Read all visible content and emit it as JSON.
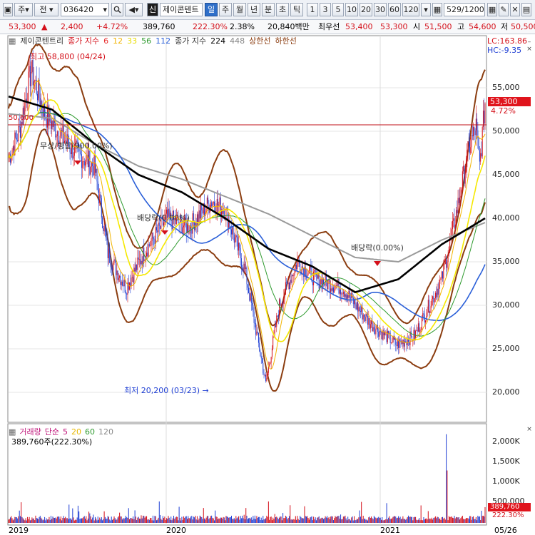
{
  "toolbar": {
    "type_label": "주",
    "market_label": "전",
    "code": "036420",
    "search_icon": "magnifier-icon",
    "sound_icon": "speaker-icon",
    "new_label": "신",
    "name": "제이콘텐트",
    "periods": [
      "일",
      "주",
      "월",
      "년",
      "분",
      "초",
      "틱"
    ],
    "period_selected": "일",
    "intervals": [
      "1",
      "3",
      "5",
      "10",
      "20",
      "30",
      "60",
      "120"
    ],
    "count": "529",
    "count_total": "/1200"
  },
  "quote": {
    "price": "53,300",
    "change_arrow": "▲",
    "change": "2,400",
    "change_pct": "+4.72%",
    "volume": "389,760",
    "volume_ratio": "222.30%",
    "turnover": "2.38%",
    "amount": "20,840백만",
    "ask_label": "최우선",
    "ask1": "53,400",
    "ask2": "53,300",
    "open_label": "시",
    "open": "51,500",
    "high_label": "고",
    "high": "54,600",
    "low_label": "저",
    "low": "50,500"
  },
  "legend": {
    "name": "제이콘텐트리",
    "ma_label": "종가 지수",
    "ma_periods": [
      "6",
      "12",
      "33",
      "56",
      "112"
    ],
    "ma2_label": "종가 지수",
    "ma2_periods": [
      "224",
      "448"
    ],
    "upper_label": "상한선",
    "lower_label": "하한선",
    "lc": "LC:163.86",
    "hc": "HC:-9.35"
  },
  "annotations": {
    "high": "최고 58,800 (04/24)",
    "low": "최저 20,200 (03/23)",
    "dividend1": "무상/병합(900.00%)",
    "dividend2": "배당락(0.00%)",
    "dividend3": "배당락(0.00%)",
    "level_label": "50,600"
  },
  "price_axis": {
    "ticks": [
      "55,000",
      "50,000",
      "45,000",
      "40,000",
      "35,000",
      "30,000",
      "25,000",
      "20,000"
    ],
    "current": "53,300",
    "current_pct": "4.72%"
  },
  "volume": {
    "label": "거래량",
    "ma_label": "단순",
    "ma_periods": [
      "5",
      "20",
      "60",
      "120"
    ],
    "current": "389,760주(222.30%)",
    "ticks": [
      "2,000K",
      "1,500K",
      "1,000K",
      "500,000"
    ],
    "current_box": "389,760",
    "current_pct": "222.30%"
  },
  "date_axis": [
    "2019",
    "2020",
    "2021",
    "05/26"
  ],
  "colors": {
    "up": "#d4101a",
    "down": "#1f3fd4",
    "ma6": "#e83030",
    "ma12": "#f2b400",
    "ma33": "#f5e800",
    "ma56": "#2e9a2e",
    "ma112": "#2a5fd8",
    "ma224": "#000000",
    "ma448": "#9a9a9a",
    "envelope": "#8b3d10"
  },
  "chart_data": {
    "type": "line",
    "x": [
      "2019-01",
      "2019-04",
      "2019-07",
      "2019-10",
      "2020-01",
      "2020-03",
      "2020-06",
      "2020-09",
      "2020-12",
      "2021-02",
      "2021-04",
      "2021-05"
    ],
    "series": [
      {
        "name": "종가",
        "values": [
          49000,
          52000,
          33000,
          40000,
          42000,
          21000,
          33000,
          31000,
          24500,
          35000,
          50000,
          53300
        ]
      },
      {
        "name": "224",
        "values": [
          54000,
          52500,
          48500,
          45000,
          43000,
          40000,
          36500,
          34500,
          31500,
          33000,
          37000,
          40000
        ]
      },
      {
        "name": "448",
        "values": [
          52000,
          51500,
          48500,
          46000,
          44500,
          42500,
          40500,
          38000,
          35500,
          35000,
          37500,
          39500
        ]
      }
    ],
    "ylim": [
      18000,
      60000
    ],
    "high": 58800,
    "low": 20200
  }
}
